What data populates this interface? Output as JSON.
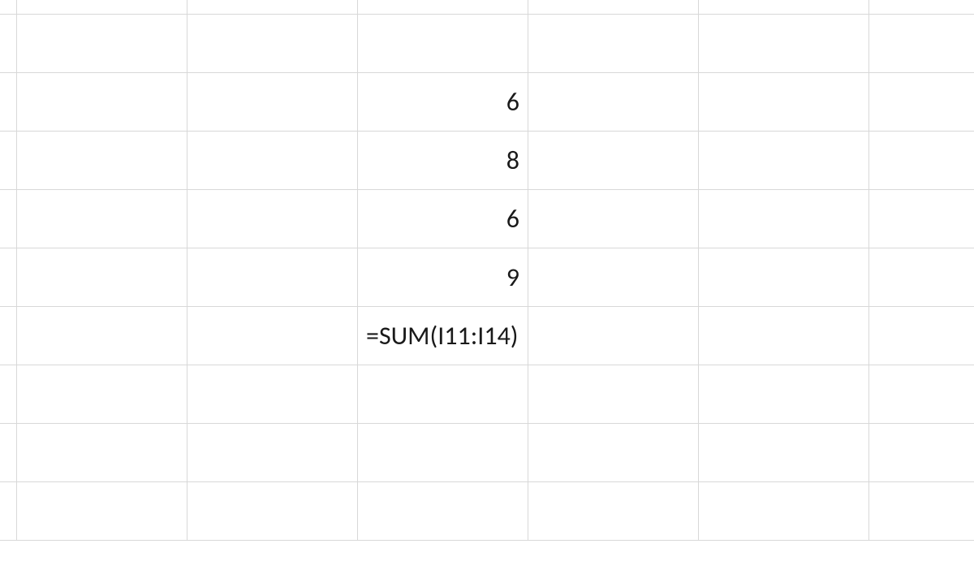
{
  "grid": {
    "rows": [
      {
        "cells": [
          "",
          "",
          "",
          "",
          "",
          "",
          ""
        ]
      },
      {
        "cells": [
          "",
          "",
          "",
          "",
          "",
          "",
          ""
        ]
      },
      {
        "cells": [
          "",
          "",
          "",
          "6",
          "",
          "",
          ""
        ],
        "numeric": [
          3
        ]
      },
      {
        "cells": [
          "",
          "",
          "",
          "8",
          "",
          "",
          ""
        ],
        "numeric": [
          3
        ]
      },
      {
        "cells": [
          "",
          "",
          "",
          "6",
          "",
          "",
          ""
        ],
        "numeric": [
          3
        ]
      },
      {
        "cells": [
          "",
          "",
          "",
          "9",
          "",
          "",
          ""
        ],
        "numeric": [
          3
        ]
      },
      {
        "cells": [
          "",
          "",
          "",
          "=SUM(I11:I14)",
          "",
          "",
          ""
        ],
        "formula": 3
      },
      {
        "cells": [
          "",
          "",
          "",
          "",
          "",
          "",
          ""
        ]
      },
      {
        "cells": [
          "",
          "",
          "",
          "",
          "",
          "",
          ""
        ]
      },
      {
        "cells": [
          "",
          "",
          "",
          "",
          "",
          "",
          ""
        ]
      },
      {
        "cells": [
          "",
          "",
          "",
          "",
          "",
          "",
          ""
        ]
      }
    ]
  }
}
